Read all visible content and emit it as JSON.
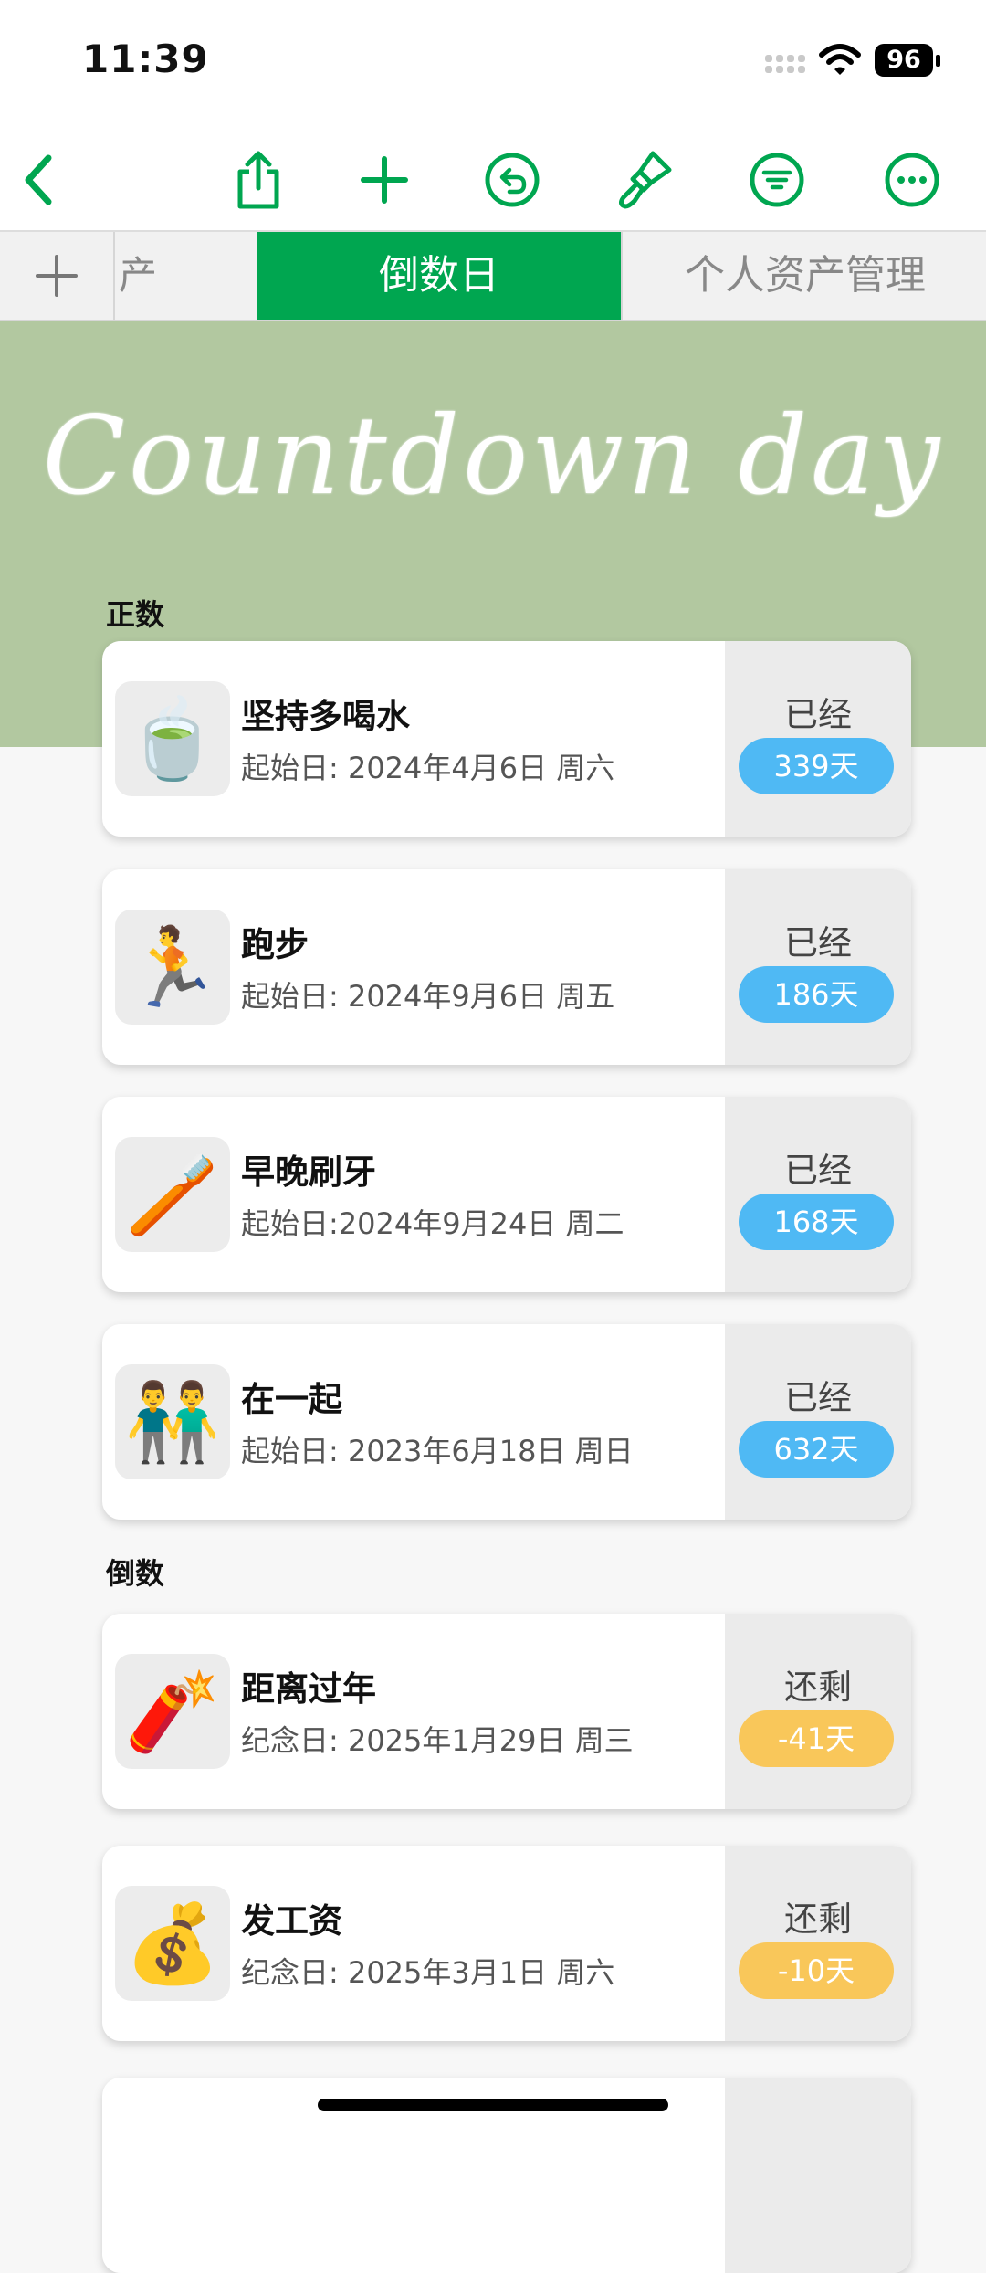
{
  "status_bar": {
    "time": "11:39",
    "battery": "96"
  },
  "toolbar": {
    "icons": [
      "back-chevron-icon",
      "share-icon",
      "plus-icon",
      "undo-icon",
      "paintbrush-icon",
      "filter-icon",
      "more-icon"
    ]
  },
  "tabs": {
    "partial_label": "产",
    "active_label": "倒数日",
    "other_label": "个人资产管理"
  },
  "banner": {
    "title": "Countdown day"
  },
  "sections": {
    "forward_label": "正数",
    "countdown_label": "倒数"
  },
  "cards": [
    {
      "icon": "🍵",
      "title": "坚持多喝水",
      "subtitle": "起始日: 2024年4月6日 周六",
      "status": "已经",
      "days": "339天"
    },
    {
      "icon": "🏃",
      "title": "跑步",
      "subtitle": "起始日: 2024年9月6日 周五",
      "status": "已经",
      "days": "186天"
    },
    {
      "icon": "🪥",
      "title": "早晚刷牙",
      "subtitle": "起始日:2024年9月24日 周二",
      "status": "已经",
      "days": "168天"
    },
    {
      "icon": "👬",
      "title": "在一起",
      "subtitle": "起始日: 2023年6月18日 周日",
      "status": "已经",
      "days": "632天"
    },
    {
      "icon": "🧨",
      "title": "距离过年",
      "subtitle": "纪念日: 2025年1月29日 周三",
      "status": "还剩",
      "days": "-41天"
    },
    {
      "icon": "💰",
      "title": "发工资",
      "subtitle": "纪念日: 2025年3月1日 周六",
      "status": "还剩",
      "days": "-10天"
    }
  ],
  "colors": {
    "accent": "#00a650",
    "banner": "#b2c8a0",
    "pill_forward": "#4fb9f4",
    "pill_countdown": "#f9c75a"
  }
}
